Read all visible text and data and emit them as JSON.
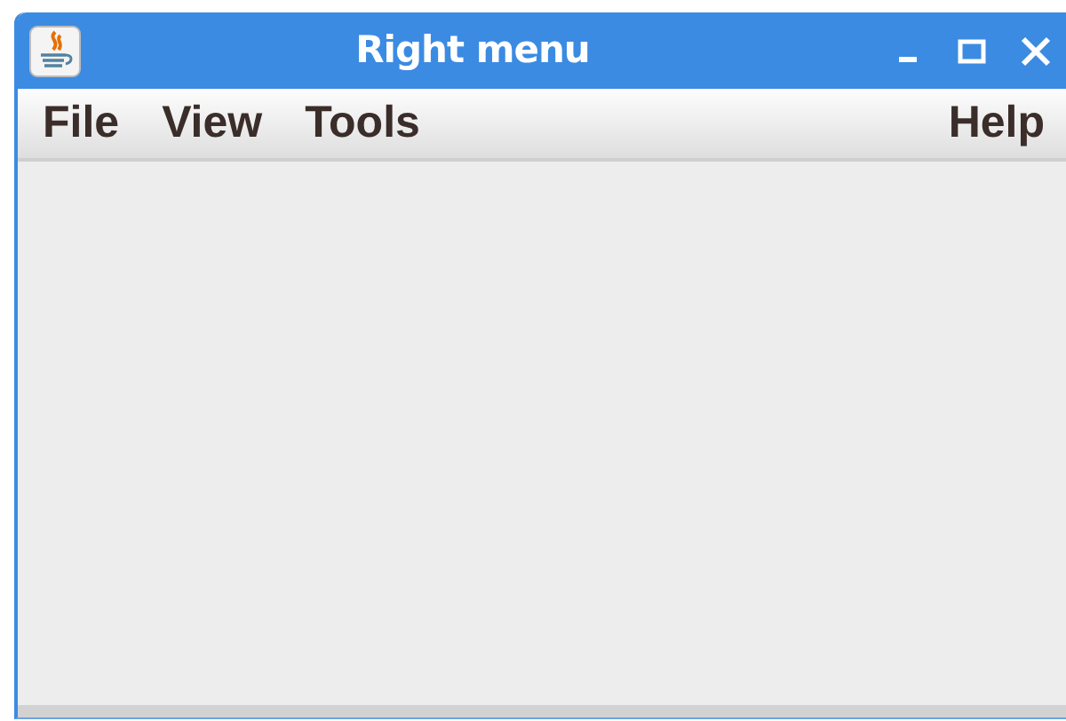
{
  "window": {
    "title": "Right menu"
  },
  "menu_bar": {
    "left_menus": [
      {
        "label": "File"
      },
      {
        "label": "View"
      },
      {
        "label": "Tools"
      }
    ],
    "right_menus": [
      {
        "label": "Help"
      }
    ]
  }
}
